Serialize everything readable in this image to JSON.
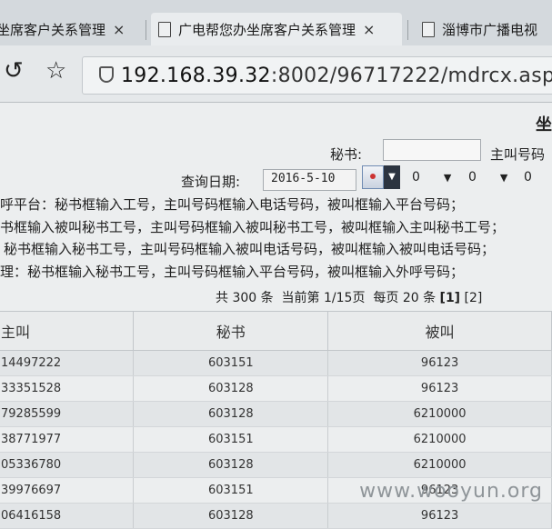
{
  "tabs": [
    {
      "label": "坐席客户关系管理",
      "active": false
    },
    {
      "label": "广电帮您办坐席客户关系管理",
      "active": true
    },
    {
      "label": "淄博市广播电视"
    }
  ],
  "browser": {
    "url_host": "192.168.39.32",
    "url_rest": ":8002/96717222/mdrcx.asp",
    "back_icon": "back-arrow-icon",
    "favorite_icon": "star-icon"
  },
  "form": {
    "title_partial": "坐",
    "secretary_label": "秘书:",
    "secretary_value": "",
    "caller_label": "主叫号码",
    "date_label": "查询日期:",
    "date_value": "2016-5-10",
    "hour_value": "0",
    "minute_value": "0",
    "second_value": "0"
  },
  "help_lines": [
    "呼平台：秘书框输入工号，主叫号码框输入电话号码，被叫框输入平台号码；",
    "书框输入被叫秘书工号，主叫号码框输入被叫秘书工号，被叫框输入主叫秘书工号；",
    "秘书框输入秘书工号，主叫号码框输入被叫电话号码，被叫框输入被叫电话号码；",
    "理：秘书框输入秘书工号，主叫号码框输入平台号码，被叫框输入外呼号码；"
  ],
  "pager": {
    "total_prefix": "共",
    "total": "300",
    "total_suffix": "条",
    "current_label": "当前第",
    "current": "1/15页",
    "per_page_label": "每页",
    "per_page": "20",
    "per_page_suffix": "条",
    "page1": "[1]",
    "page2": "[2]"
  },
  "table": {
    "headers": [
      "主叫",
      "秘书",
      "被叫"
    ],
    "rows": [
      [
        "14497222",
        "603151",
        "96123"
      ],
      [
        "33351528",
        "603128",
        "96123"
      ],
      [
        "79285599",
        "603128",
        "6210000"
      ],
      [
        "38771977",
        "603151",
        "6210000"
      ],
      [
        "05336780",
        "603128",
        "6210000"
      ],
      [
        "39976697",
        "603151",
        "96123"
      ],
      [
        "06416158",
        "603128",
        "96123"
      ]
    ]
  },
  "watermark": "www.wooyun.org"
}
